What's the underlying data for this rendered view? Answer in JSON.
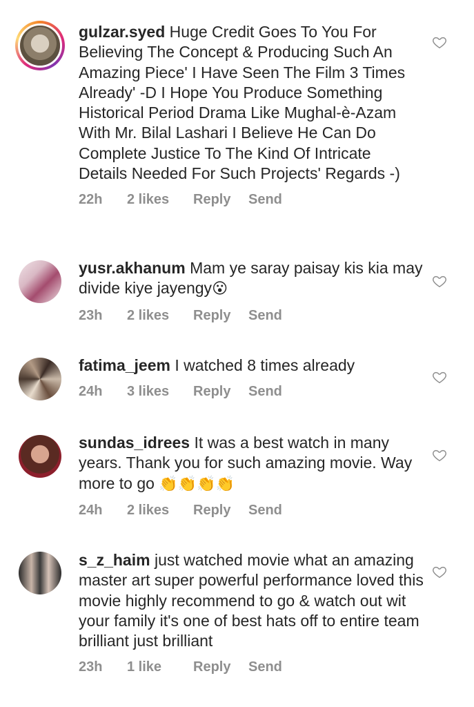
{
  "colors": {
    "text": "#262626",
    "meta": "#8e8e8e",
    "story_ring": "#dd2a7b"
  },
  "comments": [
    {
      "username": "gulzar.syed",
      "text": "Huge Credit Goes To You For Believing The Concept & Producing Such An Amazing Piece' I Have Seen The Film 3 Times Already' -D I Hope You Produce Something Historical Period Drama Like Mughal-è-Azam With Mr. Bilal Lashari I Believe He Can Do Complete Justice To The Kind Of Intricate Details Needed For Such Projects' Regards -)",
      "time": "22h",
      "likes": "2 likes",
      "reply": "Reply",
      "send": "Send",
      "avatar_icon": "masked-face-avatar",
      "has_story": true
    },
    {
      "username": "yusr.akhanum",
      "text": "Mam ye saray paisay kis kia may divide kiye jayengy",
      "emoji": "😮",
      "time": "23h",
      "likes": "2 likes",
      "reply": "Reply",
      "send": "Send",
      "avatar_icon": "woman-photo-avatar",
      "has_story": false
    },
    {
      "username": "fatima_jeem",
      "text": "I watched 8 times already",
      "time": "24h",
      "likes": "3 likes",
      "reply": "Reply",
      "send": "Send",
      "avatar_icon": "abstract-art-avatar",
      "has_story": false
    },
    {
      "username": "sundas_idrees",
      "text": "It was a best watch in many years. Thank you for such amazing movie. Way more to go",
      "emoji": "👏👏👏👏",
      "time": "24h",
      "likes": "2 likes",
      "reply": "Reply",
      "send": "Send",
      "avatar_icon": "woman-portrait-avatar",
      "has_story": false
    },
    {
      "username": "s_z_haim",
      "text": "just watched movie what an amazing master art super powerful performance loved this movie highly recommend to go & watch out wit your family it's one of best hats off to entire team brilliant just brilliant",
      "time": "23h",
      "likes": "1 like",
      "reply": "Reply",
      "send": "Send",
      "avatar_icon": "group-photo-avatar",
      "has_story": false
    }
  ]
}
